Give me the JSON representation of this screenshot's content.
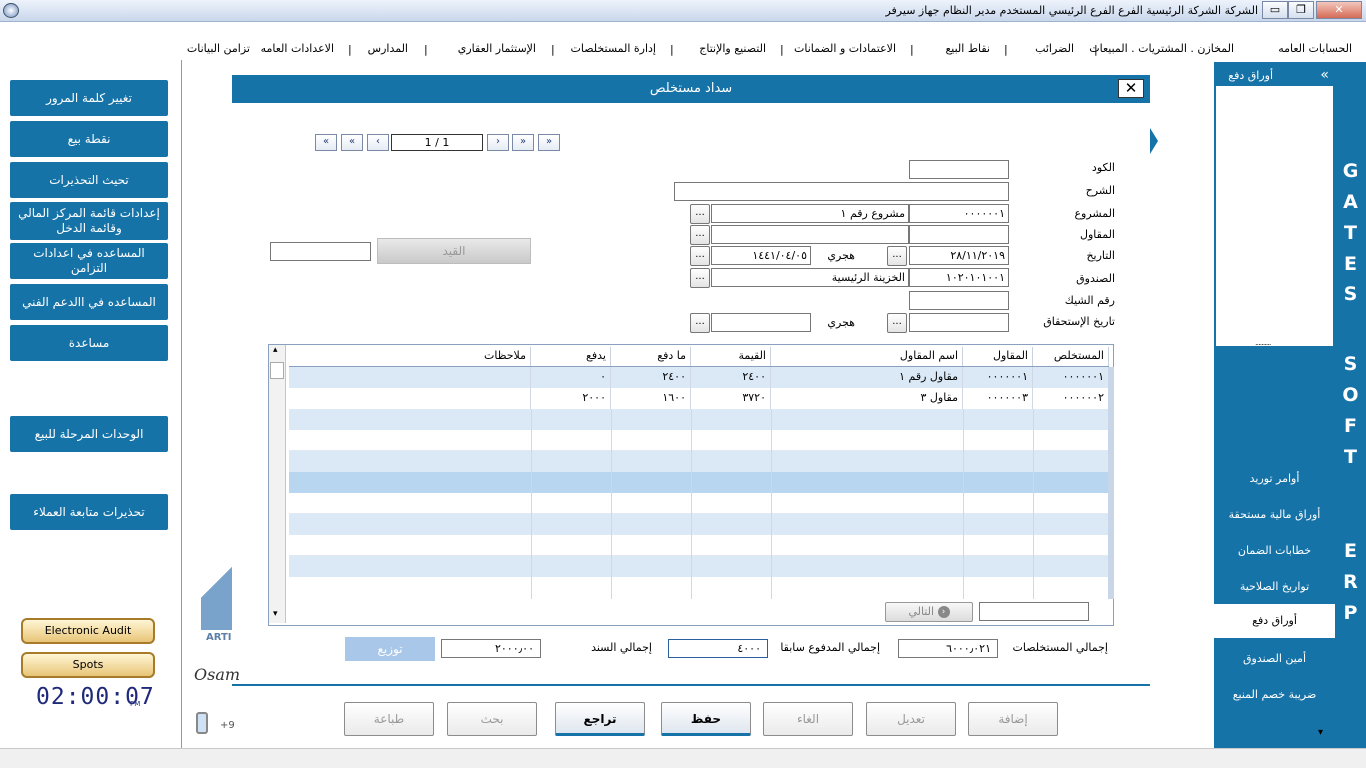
{
  "window": {
    "title": "الشركة الشركة الرئيسية   الفرع الفرع الرئيسي   المستخدم مدير النظام   جهاز سيرفر",
    "minimize": "▭",
    "restore": "❐",
    "close": "✕"
  },
  "menu": {
    "items": [
      "الحسابات العامه",
      "المخازن . المشتريات . المبيعات",
      "الضرائب",
      "نقاط البيع",
      "الاعتمادات و الضمانات",
      "التصنيع والإنتاج",
      "إدارة المستخلصات",
      "الإستثمار العقاري",
      "المدارس",
      "الاعدادات العامه",
      "تزامن البيانات"
    ]
  },
  "left_panel": {
    "buttons": [
      "تغيير كلمة المرور",
      "نقطة بيع",
      "تحيث التحذيرات",
      "إعدادات قائمة المركز المالي وقائمة الدخل",
      "المساعده في اعدادات التزامن",
      "المساعده في االدعم الفني",
      "مساعدة",
      "الوحدات المرحلة للبيع",
      "تحذيرات متابعة العملاء"
    ],
    "electronic_audit": "Electronic Audit",
    "spots": "Spots",
    "clock": "02:00:07",
    "clock_suffix": "PM",
    "logo_text": "ARTI",
    "signature": "Osam",
    "phone_prefix": "+9"
  },
  "right_panel": {
    "header": "أوراق دفع",
    "collapse": "«",
    "dotted": "..........",
    "brand_letters": [
      "G",
      "A",
      "T",
      "E",
      "S",
      "S",
      "O",
      "F",
      "T",
      "E",
      "R",
      "P"
    ],
    "nav_items": [
      "أوامر توريد",
      "أوراق مالية مستحقة",
      "خطابات الضمان",
      "تواريخ الصلاحية",
      "أوراق دفع",
      "أمين الصندوق",
      "ضريبة خصم المنبع"
    ],
    "selected": "أوراق دفع",
    "scroll_down": "▾"
  },
  "dialog": {
    "title": "سداد مستخلص",
    "close": "✕",
    "record_position": "1 / 1",
    "nav": {
      "first": "«",
      "prev_page": "«",
      "prev": "‹",
      "next": "›",
      "next_page": "»",
      "last": "»"
    },
    "labels": {
      "code": "الكود",
      "description": "الشرح",
      "project": "المشروع",
      "contractor": "المقاول",
      "date": "التاريخ",
      "fund": "الصندوق",
      "check_number": "رقم الشيك",
      "due_date": "تاريخ الإستحقاق",
      "hijri": "هجري",
      "hijri2": "هجري"
    },
    "values": {
      "code": "",
      "description": "",
      "project_code": "٠٠٠٠٠٠١",
      "project_name": "مشروع رقم ١",
      "contractor_code": "",
      "contractor_name": "",
      "date": "٢٨/١١/٢٠١٩",
      "hijri_date": "١٤٤١/٠٤/٠٥",
      "fund_code": "١٠٢٠١٠١٠٠١",
      "fund_name": "الخزينة الرئيسية",
      "check_number": "",
      "due_date": "",
      "due_hijri": ""
    },
    "dots_label": "...",
    "entry_button": "القيد",
    "entry_value": "",
    "grid": {
      "columns": [
        "المستخلص",
        "المقاول",
        "اسم المقاول",
        "القيمة",
        "ما دفع",
        "يدفع",
        "ملاحظات"
      ],
      "rows": [
        [
          "٠٠٠٠٠٠١",
          "٠٠٠٠٠٠١",
          "مقاول رقم ١",
          "٢٤٠٠",
          "٢٤٠٠",
          "٠",
          ""
        ],
        [
          "٠٠٠٠٠٠٢",
          "٠٠٠٠٠٠٣",
          "مقاول ٣",
          "٣٧٢٠",
          "١٦٠٠",
          "٢٠٠٠",
          ""
        ]
      ],
      "next_button": "التالي",
      "next_input": "",
      "scroll_up": "▴",
      "scroll_down": "▾"
    },
    "totals": {
      "total_claims_label": "إجمالي المستخلصات",
      "total_claims": "٦٠٠٠٫٠٢١",
      "paid_before_label": "إجمالي المدفوع سابقا",
      "paid_before": "٤٠٠٠",
      "voucher_total_label": "إجمالي السند",
      "voucher_total": "٢٠٠٠٫٠٠",
      "distribute_button": "توزيع"
    },
    "actions": [
      "إضافة",
      "تعديل",
      "الغاء",
      "حفظ",
      "تراجع",
      "بحث",
      "طباعة"
    ]
  },
  "colors": {
    "accent": "#1673a8",
    "row_alt": "#dbe9f7",
    "row_selected": "#b8d6f0"
  }
}
